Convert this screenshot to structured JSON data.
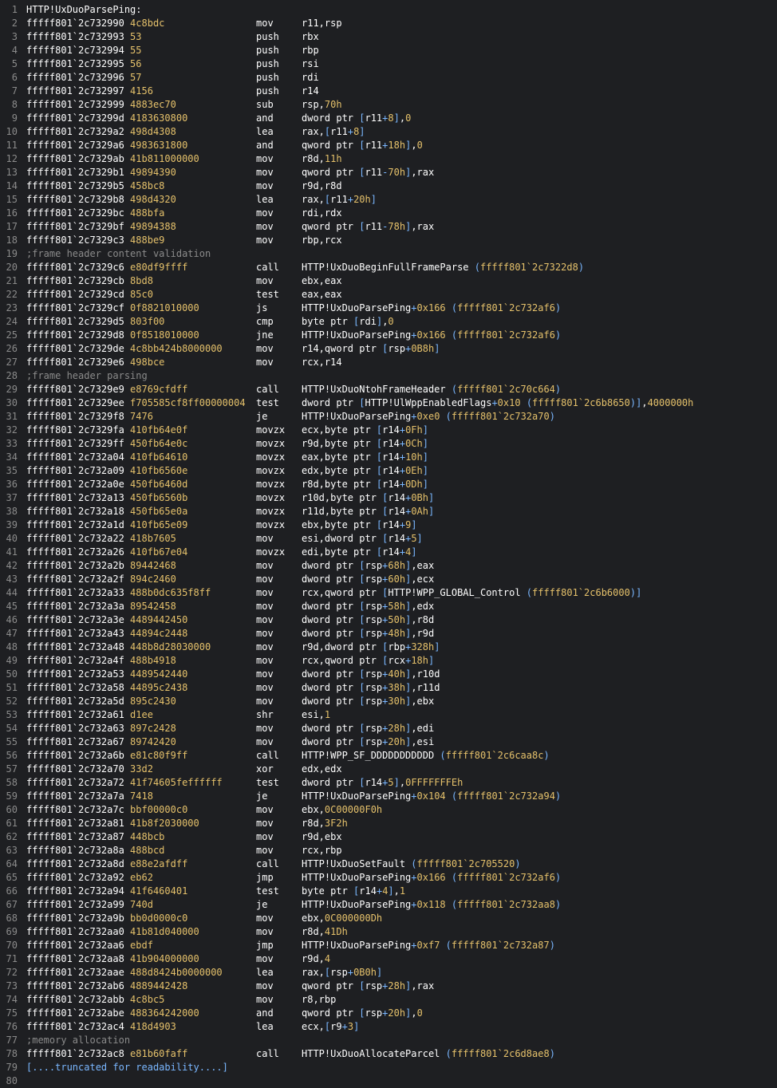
{
  "lines": [
    {
      "n": "1",
      "type": "label",
      "text": "HTTP!UxDuoParsePing:"
    },
    {
      "n": "2",
      "type": "ins",
      "addr": "fffff801`2c732990",
      "bytes": "4c8bdc",
      "mn": "mov",
      "ops": "r11,rsp"
    },
    {
      "n": "3",
      "type": "ins",
      "addr": "fffff801`2c732993",
      "bytes": "53",
      "mn": "push",
      "ops": "rbx"
    },
    {
      "n": "4",
      "type": "ins",
      "addr": "fffff801`2c732994",
      "bytes": "55",
      "mn": "push",
      "ops": "rbp"
    },
    {
      "n": "5",
      "type": "ins",
      "addr": "fffff801`2c732995",
      "bytes": "56",
      "mn": "push",
      "ops": "rsi"
    },
    {
      "n": "6",
      "type": "ins",
      "addr": "fffff801`2c732996",
      "bytes": "57",
      "mn": "push",
      "ops": "rdi"
    },
    {
      "n": "7",
      "type": "ins",
      "addr": "fffff801`2c732997",
      "bytes": "4156",
      "mn": "push",
      "ops": "r14"
    },
    {
      "n": "8",
      "type": "ins",
      "addr": "fffff801`2c732999",
      "bytes": "4883ec70",
      "mn": "sub",
      "ops": "rsp,70h"
    },
    {
      "n": "9",
      "type": "ins",
      "addr": "fffff801`2c73299d",
      "bytes": "4183630800",
      "mn": "and",
      "ops": "dword ptr [r11+8],0"
    },
    {
      "n": "10",
      "type": "ins",
      "addr": "fffff801`2c7329a2",
      "bytes": "498d4308",
      "mn": "lea",
      "ops": "rax,[r11+8]"
    },
    {
      "n": "11",
      "type": "ins",
      "addr": "fffff801`2c7329a6",
      "bytes": "4983631800",
      "mn": "and",
      "ops": "qword ptr [r11+18h],0"
    },
    {
      "n": "12",
      "type": "ins",
      "addr": "fffff801`2c7329ab",
      "bytes": "41b811000000",
      "mn": "mov",
      "ops": "r8d,11h"
    },
    {
      "n": "13",
      "type": "ins",
      "addr": "fffff801`2c7329b1",
      "bytes": "49894390",
      "mn": "mov",
      "ops": "qword ptr [r11-70h],rax"
    },
    {
      "n": "14",
      "type": "ins",
      "addr": "fffff801`2c7329b5",
      "bytes": "458bc8",
      "mn": "mov",
      "ops": "r9d,r8d"
    },
    {
      "n": "15",
      "type": "ins",
      "addr": "fffff801`2c7329b8",
      "bytes": "498d4320",
      "mn": "lea",
      "ops": "rax,[r11+20h]"
    },
    {
      "n": "16",
      "type": "ins",
      "addr": "fffff801`2c7329bc",
      "bytes": "488bfa",
      "mn": "mov",
      "ops": "rdi,rdx"
    },
    {
      "n": "17",
      "type": "ins",
      "addr": "fffff801`2c7329bf",
      "bytes": "49894388",
      "mn": "mov",
      "ops": "qword ptr [r11-78h],rax"
    },
    {
      "n": "18",
      "type": "ins",
      "addr": "fffff801`2c7329c3",
      "bytes": "488be9",
      "mn": "mov",
      "ops": "rbp,rcx"
    },
    {
      "n": "19",
      "type": "comment",
      "text": ";frame header content validation"
    },
    {
      "n": "20",
      "type": "ins",
      "addr": "fffff801`2c7329c6",
      "bytes": "e80df9ffff",
      "mn": "call",
      "ops": "HTTP!UxDuoBeginFullFrameParse (fffff801`2c7322d8)"
    },
    {
      "n": "21",
      "type": "ins",
      "addr": "fffff801`2c7329cb",
      "bytes": "8bd8",
      "mn": "mov",
      "ops": "ebx,eax"
    },
    {
      "n": "22",
      "type": "ins",
      "addr": "fffff801`2c7329cd",
      "bytes": "85c0",
      "mn": "test",
      "ops": "eax,eax"
    },
    {
      "n": "23",
      "type": "ins",
      "addr": "fffff801`2c7329cf",
      "bytes": "0f8821010000",
      "mn": "js",
      "ops": "HTTP!UxDuoParsePing+0x166 (fffff801`2c732af6)"
    },
    {
      "n": "24",
      "type": "ins",
      "addr": "fffff801`2c7329d5",
      "bytes": "803f00",
      "mn": "cmp",
      "ops": "byte ptr [rdi],0"
    },
    {
      "n": "25",
      "type": "ins",
      "addr": "fffff801`2c7329d8",
      "bytes": "0f8518010000",
      "mn": "jne",
      "ops": "HTTP!UxDuoParsePing+0x166 (fffff801`2c732af6)"
    },
    {
      "n": "26",
      "type": "ins",
      "addr": "fffff801`2c7329de",
      "bytes": "4c8bb424b8000000",
      "mn": "mov",
      "ops": "r14,qword ptr [rsp+0B8h]"
    },
    {
      "n": "27",
      "type": "ins",
      "addr": "fffff801`2c7329e6",
      "bytes": "498bce",
      "mn": "mov",
      "ops": "rcx,r14"
    },
    {
      "n": "28",
      "type": "comment",
      "text": ";frame header parsing"
    },
    {
      "n": "29",
      "type": "ins",
      "addr": "fffff801`2c7329e9",
      "bytes": "e8769cfdff",
      "mn": "call",
      "ops": "HTTP!UxDuoNtohFrameHeader (fffff801`2c70c664)"
    },
    {
      "n": "30",
      "type": "ins",
      "addr": "fffff801`2c7329ee",
      "bytes": "f705585cf8ff00000004",
      "mn": "test",
      "ops": "dword ptr [HTTP!UlWppEnabledFlags+0x10 (fffff801`2c6b8650)],4000000h"
    },
    {
      "n": "31",
      "type": "ins",
      "addr": "fffff801`2c7329f8",
      "bytes": "7476",
      "mn": "je",
      "ops": "HTTP!UxDuoParsePing+0xe0 (fffff801`2c732a70)"
    },
    {
      "n": "32",
      "type": "ins",
      "addr": "fffff801`2c7329fa",
      "bytes": "410fb64e0f",
      "mn": "movzx",
      "ops": "ecx,byte ptr [r14+0Fh]"
    },
    {
      "n": "33",
      "type": "ins",
      "addr": "fffff801`2c7329ff",
      "bytes": "450fb64e0c",
      "mn": "movzx",
      "ops": "r9d,byte ptr [r14+0Ch]"
    },
    {
      "n": "34",
      "type": "ins",
      "addr": "fffff801`2c732a04",
      "bytes": "410fb64610",
      "mn": "movzx",
      "ops": "eax,byte ptr [r14+10h]"
    },
    {
      "n": "35",
      "type": "ins",
      "addr": "fffff801`2c732a09",
      "bytes": "410fb6560e",
      "mn": "movzx",
      "ops": "edx,byte ptr [r14+0Eh]"
    },
    {
      "n": "36",
      "type": "ins",
      "addr": "fffff801`2c732a0e",
      "bytes": "450fb6460d",
      "mn": "movzx",
      "ops": "r8d,byte ptr [r14+0Dh]"
    },
    {
      "n": "37",
      "type": "ins",
      "addr": "fffff801`2c732a13",
      "bytes": "450fb6560b",
      "mn": "movzx",
      "ops": "r10d,byte ptr [r14+0Bh]"
    },
    {
      "n": "38",
      "type": "ins",
      "addr": "fffff801`2c732a18",
      "bytes": "450fb65e0a",
      "mn": "movzx",
      "ops": "r11d,byte ptr [r14+0Ah]"
    },
    {
      "n": "39",
      "type": "ins",
      "addr": "fffff801`2c732a1d",
      "bytes": "410fb65e09",
      "mn": "movzx",
      "ops": "ebx,byte ptr [r14+9]"
    },
    {
      "n": "40",
      "type": "ins",
      "addr": "fffff801`2c732a22",
      "bytes": "418b7605",
      "mn": "mov",
      "ops": "esi,dword ptr [r14+5]"
    },
    {
      "n": "41",
      "type": "ins",
      "addr": "fffff801`2c732a26",
      "bytes": "410fb67e04",
      "mn": "movzx",
      "ops": "edi,byte ptr [r14+4]"
    },
    {
      "n": "42",
      "type": "ins",
      "addr": "fffff801`2c732a2b",
      "bytes": "89442468",
      "mn": "mov",
      "ops": "dword ptr [rsp+68h],eax"
    },
    {
      "n": "43",
      "type": "ins",
      "addr": "fffff801`2c732a2f",
      "bytes": "894c2460",
      "mn": "mov",
      "ops": "dword ptr [rsp+60h],ecx"
    },
    {
      "n": "44",
      "type": "ins",
      "addr": "fffff801`2c732a33",
      "bytes": "488b0dc635f8ff",
      "mn": "mov",
      "ops": "rcx,qword ptr [HTTP!WPP_GLOBAL_Control (fffff801`2c6b6000)]"
    },
    {
      "n": "45",
      "type": "ins",
      "addr": "fffff801`2c732a3a",
      "bytes": "89542458",
      "mn": "mov",
      "ops": "dword ptr [rsp+58h],edx"
    },
    {
      "n": "46",
      "type": "ins",
      "addr": "fffff801`2c732a3e",
      "bytes": "4489442450",
      "mn": "mov",
      "ops": "dword ptr [rsp+50h],r8d"
    },
    {
      "n": "47",
      "type": "ins",
      "addr": "fffff801`2c732a43",
      "bytes": "44894c2448",
      "mn": "mov",
      "ops": "dword ptr [rsp+48h],r9d"
    },
    {
      "n": "48",
      "type": "ins",
      "addr": "fffff801`2c732a48",
      "bytes": "448b8d28030000",
      "mn": "mov",
      "ops": "r9d,dword ptr [rbp+328h]"
    },
    {
      "n": "49",
      "type": "ins",
      "addr": "fffff801`2c732a4f",
      "bytes": "488b4918",
      "mn": "mov",
      "ops": "rcx,qword ptr [rcx+18h]"
    },
    {
      "n": "50",
      "type": "ins",
      "addr": "fffff801`2c732a53",
      "bytes": "4489542440",
      "mn": "mov",
      "ops": "dword ptr [rsp+40h],r10d"
    },
    {
      "n": "51",
      "type": "ins",
      "addr": "fffff801`2c732a58",
      "bytes": "44895c2438",
      "mn": "mov",
      "ops": "dword ptr [rsp+38h],r11d"
    },
    {
      "n": "52",
      "type": "ins",
      "addr": "fffff801`2c732a5d",
      "bytes": "895c2430",
      "mn": "mov",
      "ops": "dword ptr [rsp+30h],ebx"
    },
    {
      "n": "53",
      "type": "ins",
      "addr": "fffff801`2c732a61",
      "bytes": "d1ee",
      "mn": "shr",
      "ops": "esi,1"
    },
    {
      "n": "54",
      "type": "ins",
      "addr": "fffff801`2c732a63",
      "bytes": "897c2428",
      "mn": "mov",
      "ops": "dword ptr [rsp+28h],edi"
    },
    {
      "n": "55",
      "type": "ins",
      "addr": "fffff801`2c732a67",
      "bytes": "89742420",
      "mn": "mov",
      "ops": "dword ptr [rsp+20h],esi"
    },
    {
      "n": "56",
      "type": "ins",
      "addr": "fffff801`2c732a6b",
      "bytes": "e81c80f9ff",
      "mn": "call",
      "ops": "HTTP!WPP_SF_DDDDDDDDDDD (fffff801`2c6caa8c)"
    },
    {
      "n": "57",
      "type": "ins",
      "addr": "fffff801`2c732a70",
      "bytes": "33d2",
      "mn": "xor",
      "ops": "edx,edx"
    },
    {
      "n": "58",
      "type": "ins",
      "addr": "fffff801`2c732a72",
      "bytes": "41f74605feffffff",
      "mn": "test",
      "ops": "dword ptr [r14+5],0FFFFFFFEh"
    },
    {
      "n": "59",
      "type": "ins",
      "addr": "fffff801`2c732a7a",
      "bytes": "7418",
      "mn": "je",
      "ops": "HTTP!UxDuoParsePing+0x104 (fffff801`2c732a94)"
    },
    {
      "n": "60",
      "type": "ins",
      "addr": "fffff801`2c732a7c",
      "bytes": "bbf00000c0",
      "mn": "mov",
      "ops": "ebx,0C00000F0h"
    },
    {
      "n": "61",
      "type": "ins",
      "addr": "fffff801`2c732a81",
      "bytes": "41b8f2030000",
      "mn": "mov",
      "ops": "r8d,3F2h"
    },
    {
      "n": "62",
      "type": "ins",
      "addr": "fffff801`2c732a87",
      "bytes": "448bcb",
      "mn": "mov",
      "ops": "r9d,ebx"
    },
    {
      "n": "63",
      "type": "ins",
      "addr": "fffff801`2c732a8a",
      "bytes": "488bcd",
      "mn": "mov",
      "ops": "rcx,rbp"
    },
    {
      "n": "64",
      "type": "ins",
      "addr": "fffff801`2c732a8d",
      "bytes": "e88e2afdff",
      "mn": "call",
      "ops": "HTTP!UxDuoSetFault (fffff801`2c705520)"
    },
    {
      "n": "65",
      "type": "ins",
      "addr": "fffff801`2c732a92",
      "bytes": "eb62",
      "mn": "jmp",
      "ops": "HTTP!UxDuoParsePing+0x166 (fffff801`2c732af6)"
    },
    {
      "n": "66",
      "type": "ins",
      "addr": "fffff801`2c732a94",
      "bytes": "41f6460401",
      "mn": "test",
      "ops": "byte ptr [r14+4],1"
    },
    {
      "n": "67",
      "type": "ins",
      "addr": "fffff801`2c732a99",
      "bytes": "740d",
      "mn": "je",
      "ops": "HTTP!UxDuoParsePing+0x118 (fffff801`2c732aa8)"
    },
    {
      "n": "68",
      "type": "ins",
      "addr": "fffff801`2c732a9b",
      "bytes": "bb0d0000c0",
      "mn": "mov",
      "ops": "ebx,0C000000Dh"
    },
    {
      "n": "69",
      "type": "ins",
      "addr": "fffff801`2c732aa0",
      "bytes": "41b81d040000",
      "mn": "mov",
      "ops": "r8d,41Dh"
    },
    {
      "n": "70",
      "type": "ins",
      "addr": "fffff801`2c732aa6",
      "bytes": "ebdf",
      "mn": "jmp",
      "ops": "HTTP!UxDuoParsePing+0xf7 (fffff801`2c732a87)"
    },
    {
      "n": "71",
      "type": "ins",
      "addr": "fffff801`2c732aa8",
      "bytes": "41b904000000",
      "mn": "mov",
      "ops": "r9d,4"
    },
    {
      "n": "72",
      "type": "ins",
      "addr": "fffff801`2c732aae",
      "bytes": "488d8424b0000000",
      "mn": "lea",
      "ops": "rax,[rsp+0B0h]"
    },
    {
      "n": "73",
      "type": "ins",
      "addr": "fffff801`2c732ab6",
      "bytes": "4889442428",
      "mn": "mov",
      "ops": "qword ptr [rsp+28h],rax"
    },
    {
      "n": "74",
      "type": "ins",
      "addr": "fffff801`2c732abb",
      "bytes": "4c8bc5",
      "mn": "mov",
      "ops": "r8,rbp"
    },
    {
      "n": "75",
      "type": "ins",
      "addr": "fffff801`2c732abe",
      "bytes": "488364242000",
      "mn": "and",
      "ops": "qword ptr [rsp+20h],0"
    },
    {
      "n": "76",
      "type": "ins",
      "addr": "fffff801`2c732ac4",
      "bytes": "418d4903",
      "mn": "lea",
      "ops": "ecx,[r9+3]"
    },
    {
      "n": "77",
      "type": "comment",
      "text": ";memory allocation"
    },
    {
      "n": "78",
      "type": "ins",
      "addr": "fffff801`2c732ac8",
      "bytes": "e81b60faff",
      "mn": "call",
      "ops": "HTTP!UxDuoAllocateParcel (fffff801`2c6d8ae8)"
    },
    {
      "n": "79",
      "type": "trunc",
      "text": "[....truncated for readability....]"
    },
    {
      "n": "80",
      "type": "empty"
    }
  ]
}
